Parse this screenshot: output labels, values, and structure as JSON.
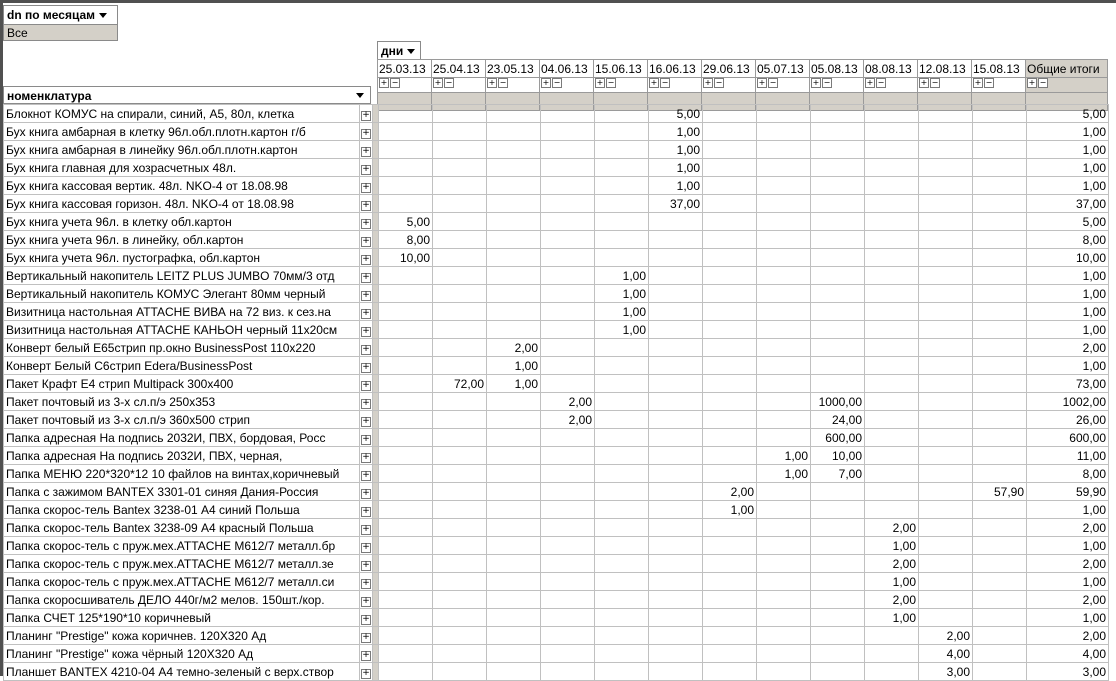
{
  "page_filter": {
    "field_label": "dn по месяцам",
    "value": "Все"
  },
  "column_field": {
    "label": "дни"
  },
  "row_field": {
    "label": "номенклатура"
  },
  "columns": [
    "25.03.13",
    "25.04.13",
    "23.05.13",
    "04.06.13",
    "15.06.13",
    "16.06.13",
    "29.06.13",
    "05.07.13",
    "05.08.13",
    "08.08.13",
    "12.08.13",
    "15.08.13",
    "Общие итоги"
  ],
  "rows": [
    {
      "name": "Блокнот КОМУС на спирали, синий, А5, 80л, клетка",
      "values": [
        "",
        "",
        "",
        "",
        "",
        "5,00",
        "",
        "",
        "",
        "",
        "",
        "",
        "5,00"
      ]
    },
    {
      "name": "Бух книга амбарная в клетку 96л.обл.плотн.картон г/б",
      "values": [
        "",
        "",
        "",
        "",
        "",
        "1,00",
        "",
        "",
        "",
        "",
        "",
        "",
        "1,00"
      ]
    },
    {
      "name": "Бух книга амбарная в линейку 96л.обл.плотн.картон",
      "values": [
        "",
        "",
        "",
        "",
        "",
        "1,00",
        "",
        "",
        "",
        "",
        "",
        "",
        "1,00"
      ]
    },
    {
      "name": "Бух книга главная для хозрасчетных 48л.",
      "values": [
        "",
        "",
        "",
        "",
        "",
        "1,00",
        "",
        "",
        "",
        "",
        "",
        "",
        "1,00"
      ]
    },
    {
      "name": "Бух книга кассовая вертик. 48л. NKO-4 от 18.08.98",
      "values": [
        "",
        "",
        "",
        "",
        "",
        "1,00",
        "",
        "",
        "",
        "",
        "",
        "",
        "1,00"
      ]
    },
    {
      "name": "Бух книга кассовая горизон. 48л. NKO-4 от 18.08.98",
      "values": [
        "",
        "",
        "",
        "",
        "",
        "37,00",
        "",
        "",
        "",
        "",
        "",
        "",
        "37,00"
      ]
    },
    {
      "name": "Бух книга учета 96л. в клетку обл.картон",
      "values": [
        "5,00",
        "",
        "",
        "",
        "",
        "",
        "",
        "",
        "",
        "",
        "",
        "",
        "5,00"
      ]
    },
    {
      "name": "Бух книга учета 96л. в линейку, обл.картон",
      "values": [
        "8,00",
        "",
        "",
        "",
        "",
        "",
        "",
        "",
        "",
        "",
        "",
        "",
        "8,00"
      ]
    },
    {
      "name": "Бух книга учета 96л. пустографка, обл.картон",
      "values": [
        "10,00",
        "",
        "",
        "",
        "",
        "",
        "",
        "",
        "",
        "",
        "",
        "",
        "10,00"
      ]
    },
    {
      "name": "Вертикальный накопитель LEITZ PLUS JUMBO 70мм/3 отд",
      "values": [
        "",
        "",
        "",
        "",
        "1,00",
        "",
        "",
        "",
        "",
        "",
        "",
        "",
        "1,00"
      ]
    },
    {
      "name": "Вертикальный накопитель КОМУС Элегант 80мм черный",
      "values": [
        "",
        "",
        "",
        "",
        "1,00",
        "",
        "",
        "",
        "",
        "",
        "",
        "",
        "1,00"
      ]
    },
    {
      "name": "Визитница настольная ATTACHE ВИВА на 72 виз. к сез.на",
      "values": [
        "",
        "",
        "",
        "",
        "1,00",
        "",
        "",
        "",
        "",
        "",
        "",
        "",
        "1,00"
      ]
    },
    {
      "name": "Визитница настольная ATTACHE КАНЬОН черный 11х20см",
      "values": [
        "",
        "",
        "",
        "",
        "1,00",
        "",
        "",
        "",
        "",
        "",
        "",
        "",
        "1,00"
      ]
    },
    {
      "name": "Конверт белый Е65стрип пр.окно BusinessPost 110х220",
      "values": [
        "",
        "",
        "2,00",
        "",
        "",
        "",
        "",
        "",
        "",
        "",
        "",
        "",
        "2,00"
      ]
    },
    {
      "name": "Конверт Белый С6стрип Edera/BusinessPost",
      "values": [
        "",
        "",
        "1,00",
        "",
        "",
        "",
        "",
        "",
        "",
        "",
        "",
        "",
        "1,00"
      ]
    },
    {
      "name": "Пакет Крафт Е4 стрип Multipack 300х400",
      "values": [
        "",
        "72,00",
        "1,00",
        "",
        "",
        "",
        "",
        "",
        "",
        "",
        "",
        "",
        "73,00"
      ]
    },
    {
      "name": "Пакет почтовый из 3-х сл.п/э 250х353",
      "values": [
        "",
        "",
        "",
        "2,00",
        "",
        "",
        "",
        "",
        "1000,00",
        "",
        "",
        "",
        "1002,00"
      ]
    },
    {
      "name": "Пакет почтовый из 3-х сл.п/э 360х500 стрип",
      "values": [
        "",
        "",
        "",
        "2,00",
        "",
        "",
        "",
        "",
        "24,00",
        "",
        "",
        "",
        "26,00"
      ]
    },
    {
      "name": "Папка адресная На подпись  2032И, ПВХ, бордовая, Росс",
      "values": [
        "",
        "",
        "",
        "",
        "",
        "",
        "",
        "",
        "600,00",
        "",
        "",
        "",
        "600,00"
      ]
    },
    {
      "name": "Папка адресная На подпись 2032И, ПВХ, черная,",
      "values": [
        "",
        "",
        "",
        "",
        "",
        "",
        "",
        "1,00",
        "10,00",
        "",
        "",
        "",
        "11,00"
      ]
    },
    {
      "name": "Папка МЕНЮ 220*320*12 10 файлов на винтах,коричневый",
      "values": [
        "",
        "",
        "",
        "",
        "",
        "",
        "",
        "1,00",
        "7,00",
        "",
        "",
        "",
        "8,00"
      ]
    },
    {
      "name": "Папка с зажимом BANTEX 3301-01 синяя Дания-Россия",
      "values": [
        "",
        "",
        "",
        "",
        "",
        "",
        "2,00",
        "",
        "",
        "",
        "",
        "57,90",
        "59,90"
      ]
    },
    {
      "name": "Папка скорос-тель Bantex 3238-01 А4 синий Польша",
      "values": [
        "",
        "",
        "",
        "",
        "",
        "",
        "1,00",
        "",
        "",
        "",
        "",
        "",
        "1,00"
      ]
    },
    {
      "name": "Папка скорос-тель Bantex 3238-09 А4 красный Польша",
      "values": [
        "",
        "",
        "",
        "",
        "",
        "",
        "",
        "",
        "",
        "2,00",
        "",
        "",
        "2,00"
      ]
    },
    {
      "name": "Папка скорос-тель с пруж.мех.ATTACHE M612/7 металл.бр",
      "values": [
        "",
        "",
        "",
        "",
        "",
        "",
        "",
        "",
        "",
        "1,00",
        "",
        "",
        "1,00"
      ]
    },
    {
      "name": "Папка скорос-тель с пруж.мех.ATTACHE M612/7 металл.зе",
      "values": [
        "",
        "",
        "",
        "",
        "",
        "",
        "",
        "",
        "",
        "2,00",
        "",
        "",
        "2,00"
      ]
    },
    {
      "name": "Папка скорос-тель с пруж.мех.ATTACHE M612/7 металл.си",
      "values": [
        "",
        "",
        "",
        "",
        "",
        "",
        "",
        "",
        "",
        "1,00",
        "",
        "",
        "1,00"
      ]
    },
    {
      "name": "Папка скоросшиватель ДЕЛО 440г/м2 мелов. 150шт./кор.",
      "values": [
        "",
        "",
        "",
        "",
        "",
        "",
        "",
        "",
        "",
        "2,00",
        "",
        "",
        "2,00"
      ]
    },
    {
      "name": "Папка СЧЕТ 125*190*10 коричневый",
      "values": [
        "",
        "",
        "",
        "",
        "",
        "",
        "",
        "",
        "",
        "1,00",
        "",
        "",
        "1,00"
      ]
    },
    {
      "name": "Планинг \"Prestige\" кожа коричнев. 120Х320 Ад",
      "values": [
        "",
        "",
        "",
        "",
        "",
        "",
        "",
        "",
        "",
        "",
        "2,00",
        "",
        "2,00"
      ]
    },
    {
      "name": "Планинг \"Prestige\" кожа чёрный 120Х320 Ад",
      "values": [
        "",
        "",
        "",
        "",
        "",
        "",
        "",
        "",
        "",
        "",
        "4,00",
        "",
        "4,00"
      ]
    },
    {
      "name": "Планшет BANTEX 4210-04 А4 темно-зеленый с верх.створ",
      "values": [
        "",
        "",
        "",
        "",
        "",
        "",
        "",
        "",
        "",
        "",
        "3,00",
        "",
        "3,00"
      ]
    }
  ],
  "expand_glyph": "+",
  "collapse_glyph": "−",
  "colors": {
    "header_grey": "#d4d0c8",
    "grid_line": "#c0c0c0",
    "frame": "#505050"
  }
}
